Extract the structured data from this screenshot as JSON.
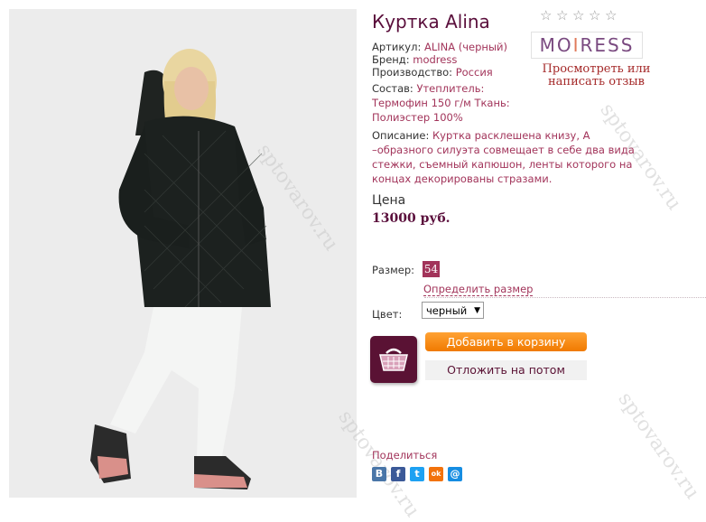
{
  "product": {
    "title": "Куртка Alina",
    "rows": [
      {
        "label": "Артикул:",
        "value": "ALINA (черный)"
      },
      {
        "label": "Бренд:",
        "value": "modress"
      },
      {
        "label": "Производство:",
        "value": "Россия"
      }
    ],
    "composition_label": "Состав:",
    "composition_lines": [
      "Утеплитель:",
      "Термофин 150 г/м Ткань:",
      "Полиэстер 100%"
    ],
    "description_label": "Описание:",
    "description_lines": [
      "Куртка расклешена книзу, А",
      "–образного силуэта совмещает в себе два вида",
      "стежки, съемный капюшон, ленты которого на",
      "концах декорированы стразами."
    ]
  },
  "rating": {
    "stars": 5,
    "filled": 0,
    "star_char": "☆"
  },
  "brand_logo": {
    "left": "MO",
    "mid": "I",
    "right": "RESS"
  },
  "review_link": "Просмотреть или написать отзыв",
  "price": {
    "label": "Цена",
    "value": "13000 руб."
  },
  "size": {
    "label": "Размер:",
    "value": "54",
    "link": "Определить размер"
  },
  "color": {
    "label": "Цвет:",
    "value": "черный"
  },
  "buttons": {
    "add_to_cart": "Добавить в корзину",
    "save_for_later": "Отложить на потом"
  },
  "share": {
    "label": "Поделиться",
    "icons": [
      {
        "name": "vk-icon",
        "glyph": "В",
        "color": "#4a76a8"
      },
      {
        "name": "facebook-icon",
        "glyph": "f",
        "color": "#3b5998"
      },
      {
        "name": "twitter-icon",
        "glyph": "t",
        "color": "#1da1f2"
      },
      {
        "name": "odnoklassniki-icon",
        "glyph": "ok",
        "color": "#f2720c"
      },
      {
        "name": "mail-icon",
        "glyph": "@",
        "color": "#168de2"
      }
    ]
  },
  "watermark": "sptovarov.ru",
  "colors": {
    "accent": "#a2345a",
    "title": "#5a0e3b",
    "button": "#f07a00"
  }
}
